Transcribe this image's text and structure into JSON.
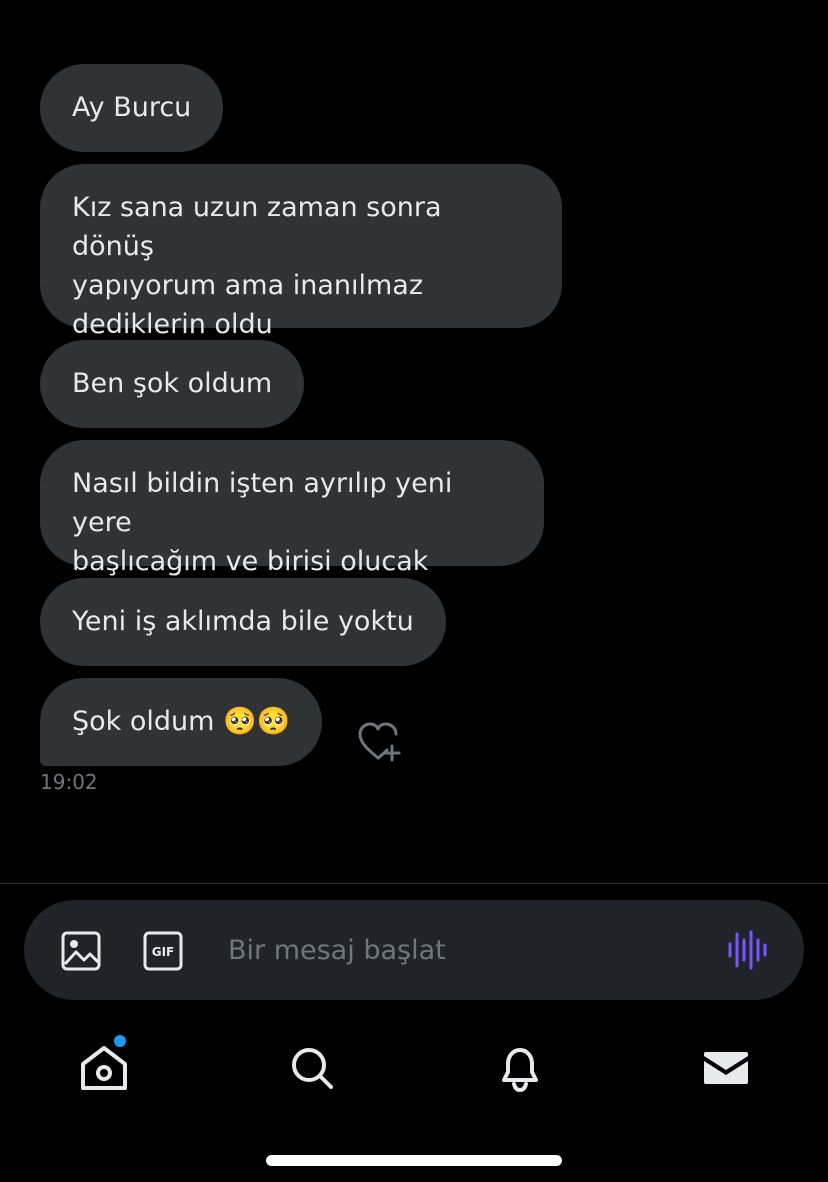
{
  "conversation": {
    "messages": [
      {
        "text": "Ay Burcu"
      },
      {
        "text": "Kız sana uzun zaman sonra dönüş\nyapıyorum ama inanılmaz\ndediklerin oldu"
      },
      {
        "text": "Ben şok oldum"
      },
      {
        "text": "Nasıl bildin işten ayrılıp yeni yere\nbaşlıcağım ve birisi olucak dedin"
      },
      {
        "text": "Yeni iş aklımda bile yoktu"
      },
      {
        "text": "Şok oldum 🥺🥺"
      }
    ],
    "timestamp": "19:02"
  },
  "composer": {
    "placeholder": "Bir mesaj başlat",
    "image_icon": "image-icon",
    "gif_icon": "gif-icon",
    "gif_label": "GIF",
    "voice_icon": "voice-waveform-icon"
  },
  "tabbar": {
    "items": [
      {
        "icon": "home-icon",
        "has_notification_dot": true
      },
      {
        "icon": "search-icon"
      },
      {
        "icon": "bell-icon"
      },
      {
        "icon": "mail-icon"
      }
    ]
  },
  "colors": {
    "background": "#000000",
    "bubble": "#2f3336",
    "text": "#e7e9ea",
    "muted": "#71767b",
    "accent_purple": "#7856ff",
    "notification_blue": "#1d9bf0"
  }
}
